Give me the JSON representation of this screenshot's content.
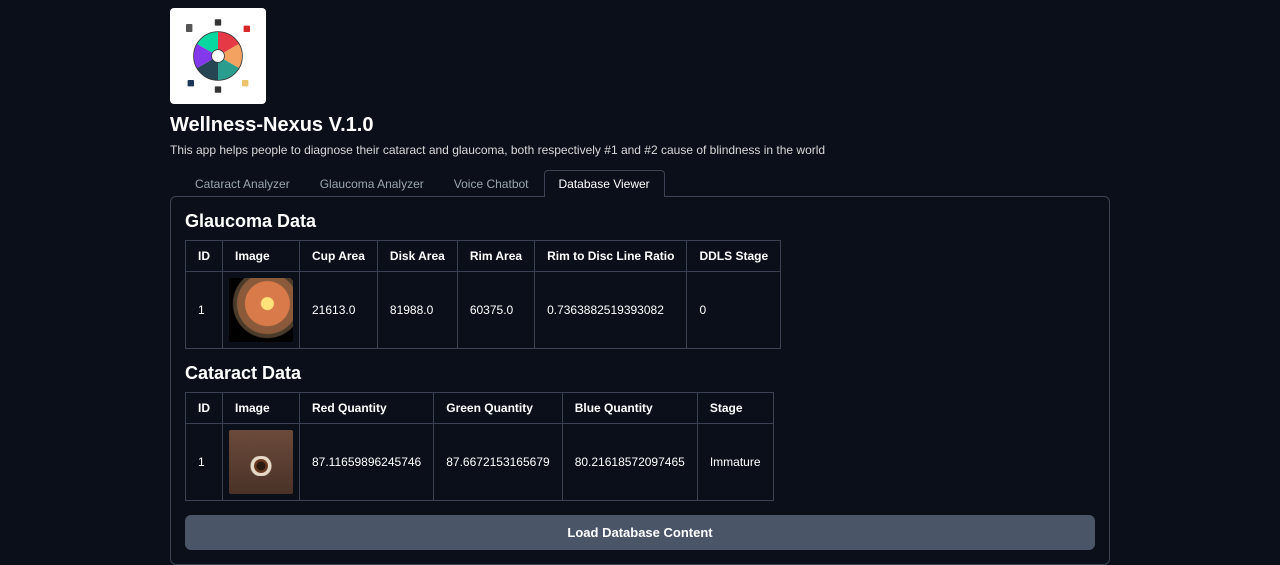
{
  "header": {
    "title": "Wellness-Nexus V.1.0",
    "description": "This app helps people to diagnose their cataract and glaucoma, both respectively #1 and #2 cause of blindness in the world"
  },
  "tabs": [
    {
      "label": "Cataract Analyzer",
      "active": false
    },
    {
      "label": "Glaucoma Analyzer",
      "active": false
    },
    {
      "label": "Voice Chatbot",
      "active": false
    },
    {
      "label": "Database Viewer",
      "active": true
    }
  ],
  "glaucoma": {
    "title": "Glaucoma Data",
    "headers": [
      "ID",
      "Image",
      "Cup Area",
      "Disk Area",
      "Rim Area",
      "Rim to Disc Line Ratio",
      "DDLS Stage"
    ],
    "row": {
      "id": "1",
      "image_alt": "retina-fundus",
      "cup_area": "21613.0",
      "disk_area": "81988.0",
      "rim_area": "60375.0",
      "ratio": "0.7363882519393082",
      "ddls": "0"
    }
  },
  "cataract": {
    "title": "Cataract Data",
    "headers": [
      "ID",
      "Image",
      "Red Quantity",
      "Green Quantity",
      "Blue Quantity",
      "Stage"
    ],
    "row": {
      "id": "1",
      "image_alt": "eye-photo",
      "red": "87.11659896245746",
      "green": "87.6672153165679",
      "blue": "80.21618572097465",
      "stage": "Immature"
    }
  },
  "actions": {
    "load_button": "Load Database Content"
  }
}
